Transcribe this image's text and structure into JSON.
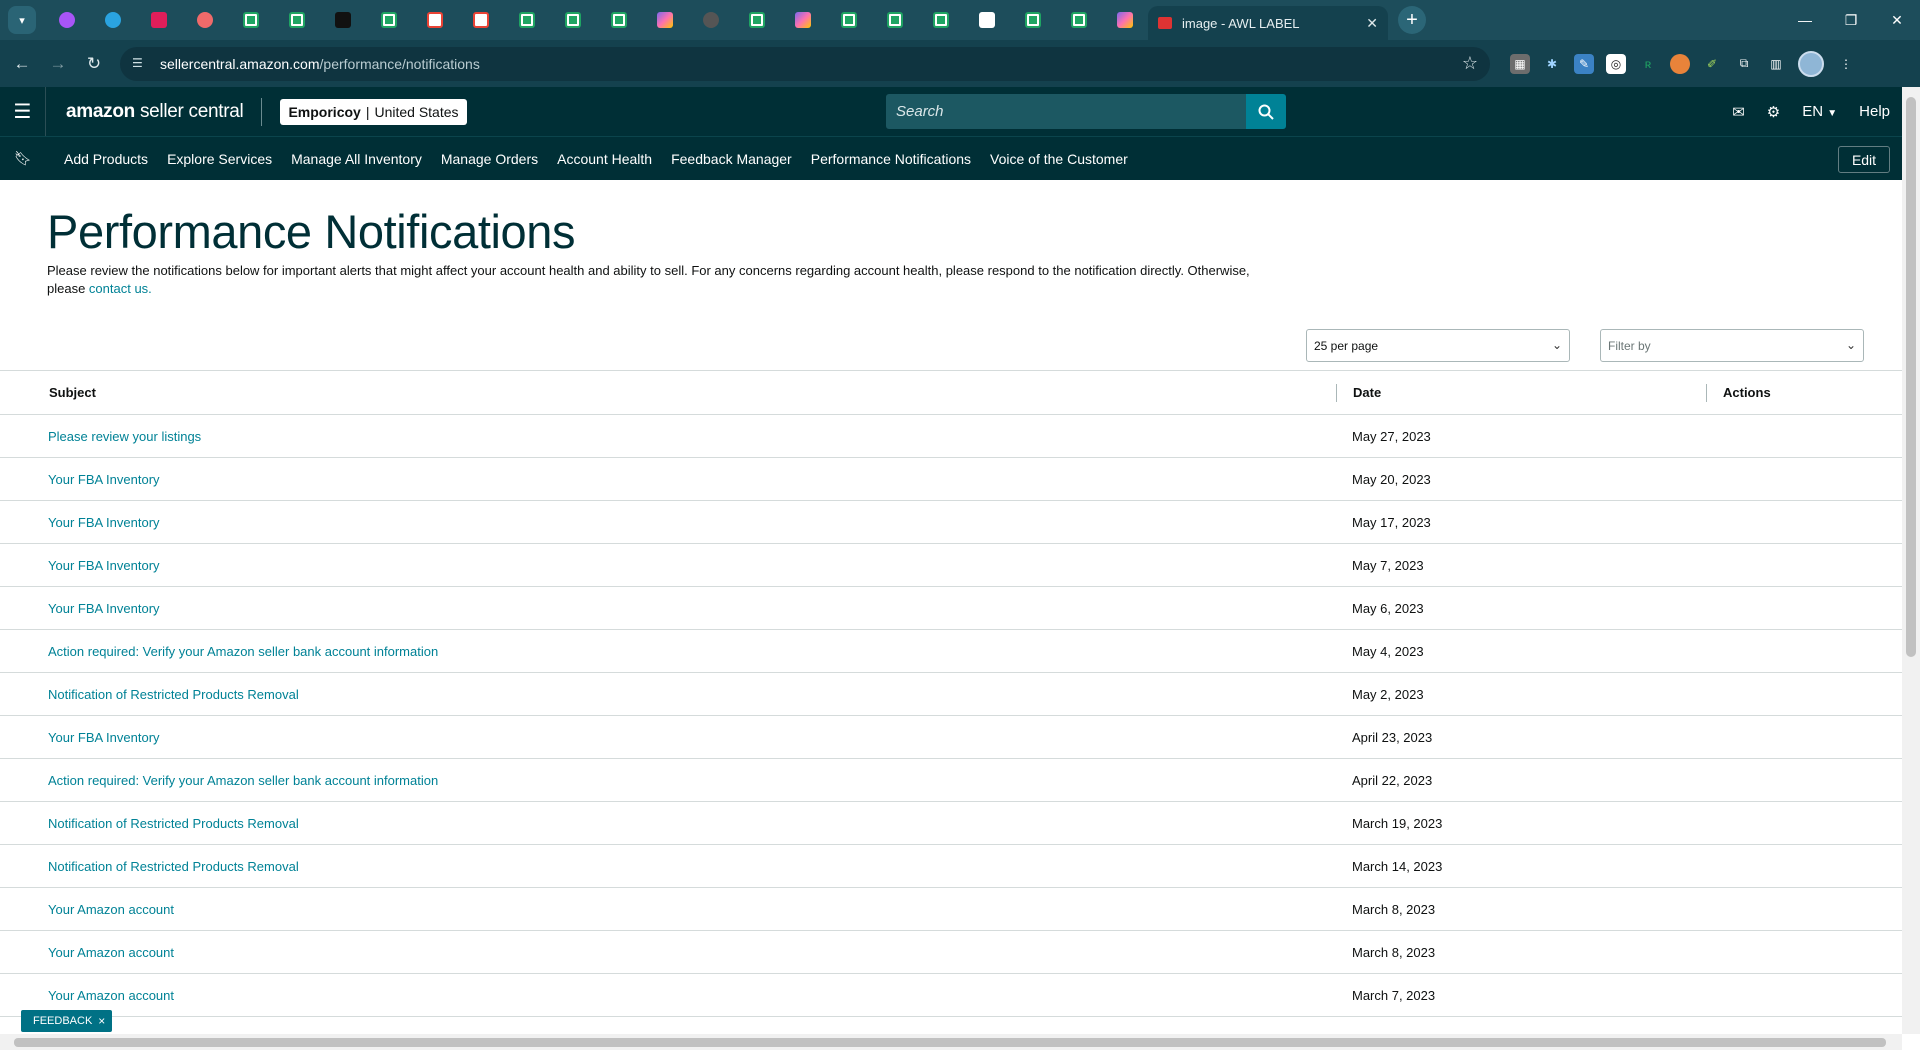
{
  "browser": {
    "active_tab_title": "image - AWL LABEL",
    "url_host": "sellercentral.amazon.com",
    "url_path": "/performance/notifications",
    "pinned_tabs": [
      "messenger-icon",
      "telegram-icon",
      "slack-icon",
      "asana-icon",
      "sheets-icon",
      "sheets-icon",
      "amazon-icon",
      "sheets-icon",
      "gmail-icon",
      "gmail-icon",
      "sheets-icon",
      "sheets-icon",
      "sheets-icon",
      "clickup-icon",
      "circle-icon",
      "sheets-icon",
      "clickup-icon",
      "sheets-icon",
      "sheets-icon",
      "sheets-icon",
      "upwork-icon",
      "sheets-icon",
      "sheets-icon",
      "clickup-icon"
    ]
  },
  "header": {
    "logo_amazon": "amazon",
    "logo_sc": "seller central",
    "account_name": "Emporicoy",
    "account_separator": "|",
    "account_region": "United States",
    "search_placeholder": "Search",
    "language": "EN",
    "help": "Help"
  },
  "nav": {
    "links": [
      "Add Products",
      "Explore Services",
      "Manage All Inventory",
      "Manage Orders",
      "Account Health",
      "Feedback Manager",
      "Performance Notifications",
      "Voice of the Customer"
    ],
    "edit": "Edit"
  },
  "page": {
    "title": "Performance Notifications",
    "intro_text": "Please review the notifications below for important alerts that might affect your account health and ability to sell. For any concerns regarding account health, please respond to the notification directly. Otherwise, please ",
    "intro_link": "contact us.",
    "per_page": "25 per page",
    "filter_placeholder": "Filter by"
  },
  "table": {
    "headers": {
      "subject": "Subject",
      "date": "Date",
      "actions": "Actions"
    },
    "rows": [
      {
        "subject": "Please review your listings",
        "date": "May 27, 2023"
      },
      {
        "subject": "Your FBA Inventory",
        "date": "May 20, 2023"
      },
      {
        "subject": "Your FBA Inventory",
        "date": "May 17, 2023"
      },
      {
        "subject": "Your FBA Inventory",
        "date": "May 7, 2023"
      },
      {
        "subject": "Your FBA Inventory",
        "date": "May 6, 2023"
      },
      {
        "subject": "Action required: Verify your Amazon seller bank account information",
        "date": "May 4, 2023"
      },
      {
        "subject": "Notification of Restricted Products Removal",
        "date": "May 2, 2023"
      },
      {
        "subject": "Your FBA Inventory",
        "date": "April 23, 2023"
      },
      {
        "subject": "Action required: Verify your Amazon seller bank account information",
        "date": "April 22, 2023"
      },
      {
        "subject": "Notification of Restricted Products Removal",
        "date": "March 19, 2023"
      },
      {
        "subject": "Notification of Restricted Products Removal",
        "date": "March 14, 2023"
      },
      {
        "subject": "Your Amazon account",
        "date": "March 8, 2023"
      },
      {
        "subject": "Your Amazon account",
        "date": "March 8, 2023"
      },
      {
        "subject": "Your Amazon account",
        "date": "March 7, 2023"
      }
    ]
  },
  "feedback": {
    "label": "FEEDBACK",
    "close": "×"
  },
  "colors": {
    "header_bg": "#002f36",
    "link": "#008296",
    "browser_tab_bg": "#1d4d5b"
  }
}
